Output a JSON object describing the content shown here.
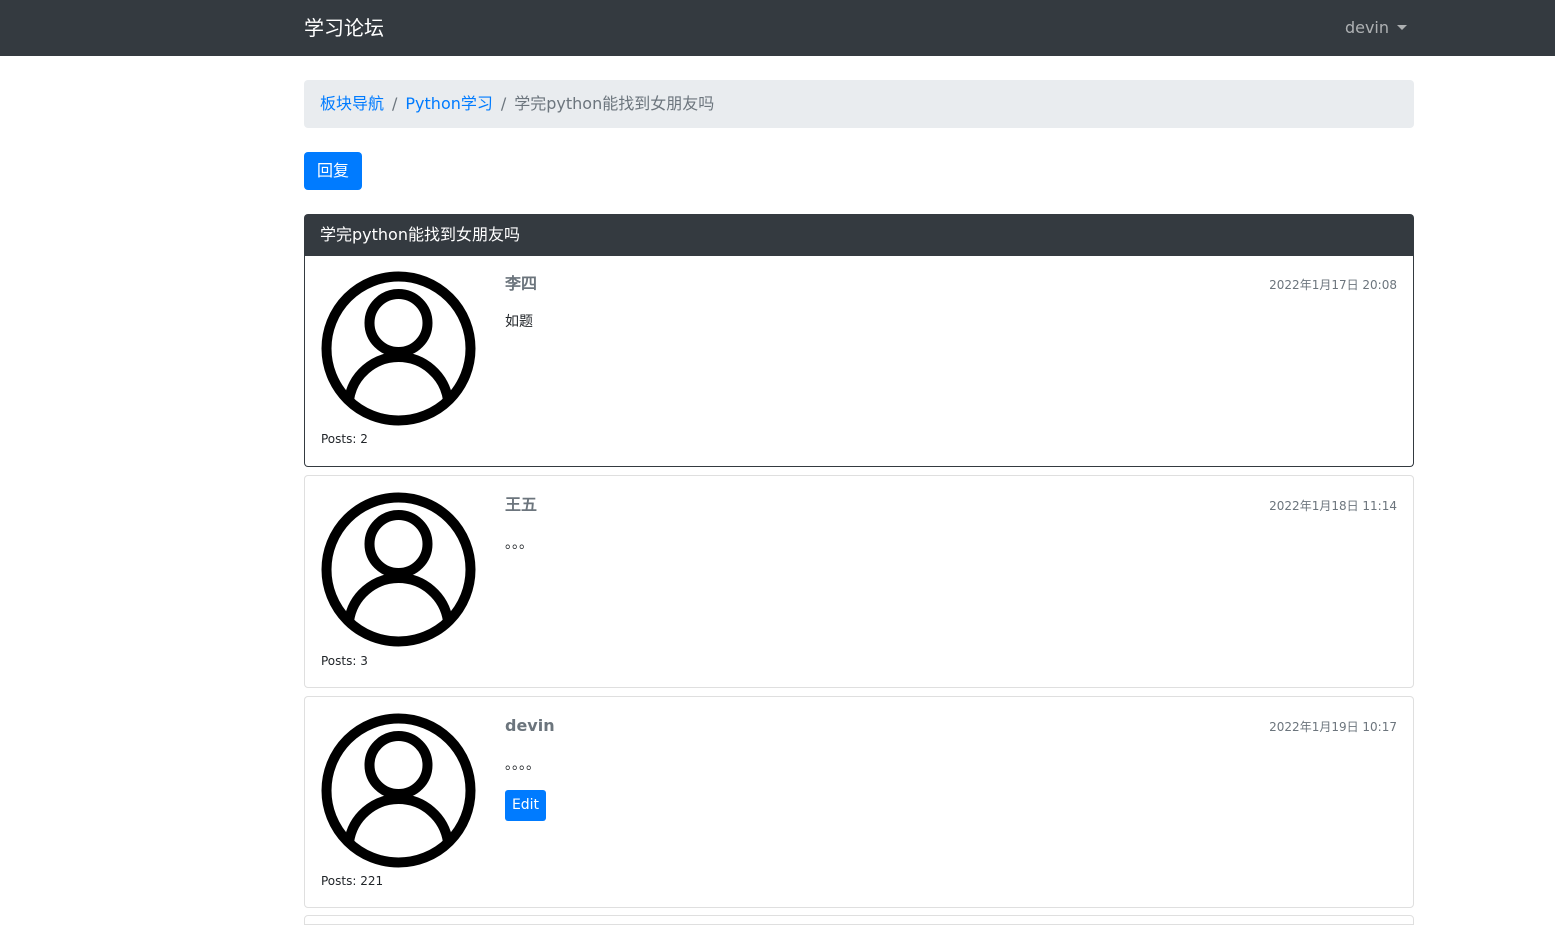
{
  "navbar": {
    "brand": "学习论坛",
    "user": "devin"
  },
  "breadcrumb": {
    "items": [
      {
        "label": "板块导航"
      },
      {
        "label": "Python学习"
      },
      {
        "label": "学完python能找到女朋友吗"
      }
    ],
    "separator": "/"
  },
  "actions": {
    "reply_label": "回复"
  },
  "thread": {
    "title": "学完python能找到女朋友吗"
  },
  "posts": [
    {
      "author": "李四",
      "time": "2022年1月17日 20:08",
      "content": "如题",
      "posts_count": "Posts: 2"
    },
    {
      "author": "王五",
      "time": "2022年1月18日 11:14",
      "content": "。。。",
      "posts_count": "Posts: 3"
    },
    {
      "author": "devin",
      "time": "2022年1月19日 10:17",
      "content": "。。。。",
      "posts_count": "Posts: 221",
      "edit_label": "Edit"
    }
  ],
  "icons": {
    "avatar": "user-circle-icon",
    "dropdown": "caret-down-icon"
  },
  "colors": {
    "navbar": "#343a40",
    "primary": "#007bff",
    "breadcrumb_bg": "#e9ecef",
    "muted": "#6c757d"
  }
}
